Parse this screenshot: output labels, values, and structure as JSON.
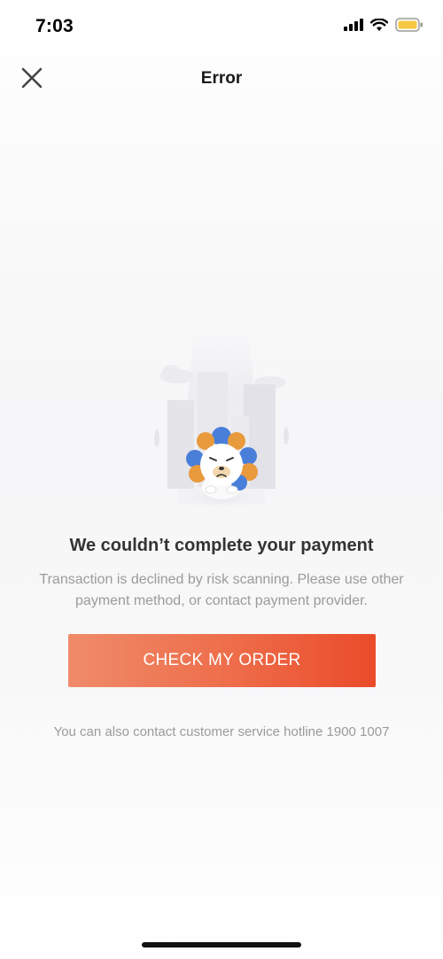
{
  "status_bar": {
    "time": "7:03",
    "icons": [
      "signal-icon",
      "wifi-icon",
      "battery-icon"
    ],
    "battery_color": "#f7c843"
  },
  "nav": {
    "title": "Error",
    "close_icon": "close-icon"
  },
  "illustration": {
    "icon": "sad-lion-mascot-illustration",
    "mane_colors": [
      "#4a7fd9",
      "#e89a3c"
    ]
  },
  "message": {
    "headline": "We couldn’t complete your payment",
    "description": "Transaction is declined by risk scanning. Please use other payment method, or contact payment provider."
  },
  "cta": {
    "label": "CHECK MY ORDER",
    "gradient_start": "#ef8b69",
    "gradient_end": "#ea4b2a"
  },
  "footer": {
    "hotline_text": "You can also contact customer service hotline 1900 1007"
  }
}
